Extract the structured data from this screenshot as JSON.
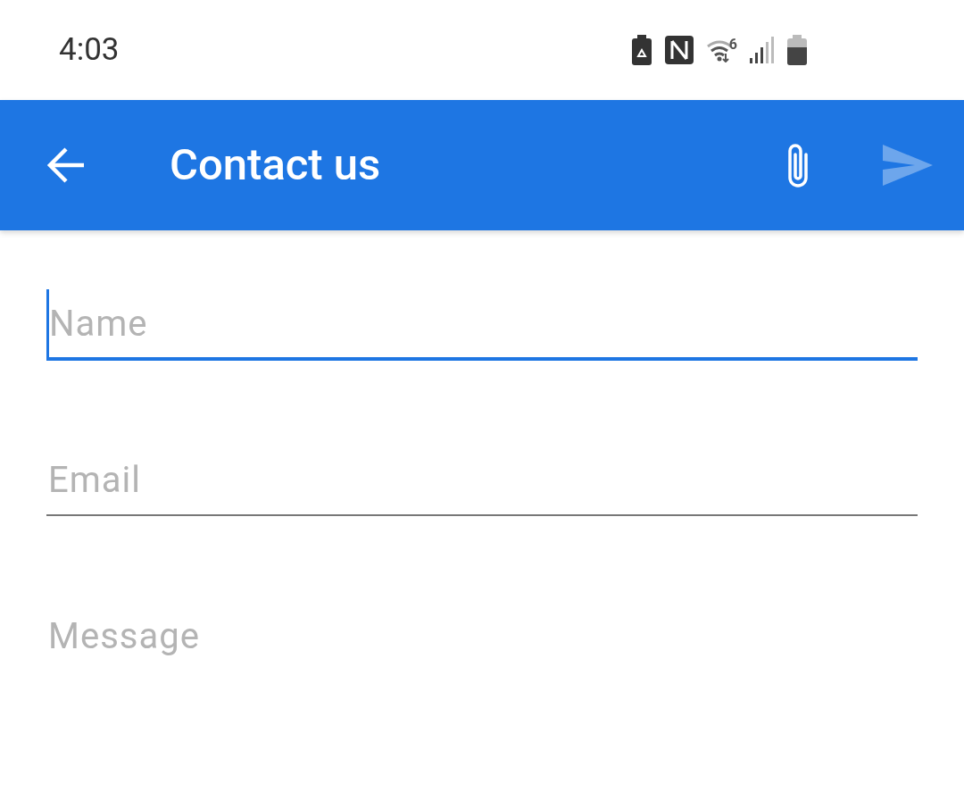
{
  "status_bar": {
    "time": "4:03",
    "wifi_badge": "6"
  },
  "app_bar": {
    "title": "Contact us",
    "send_disabled": true
  },
  "fields": [
    {
      "placeholder": "Name",
      "focused": true
    },
    {
      "placeholder": "Email",
      "focused": false
    },
    {
      "placeholder": "Message",
      "focused": false
    }
  ]
}
